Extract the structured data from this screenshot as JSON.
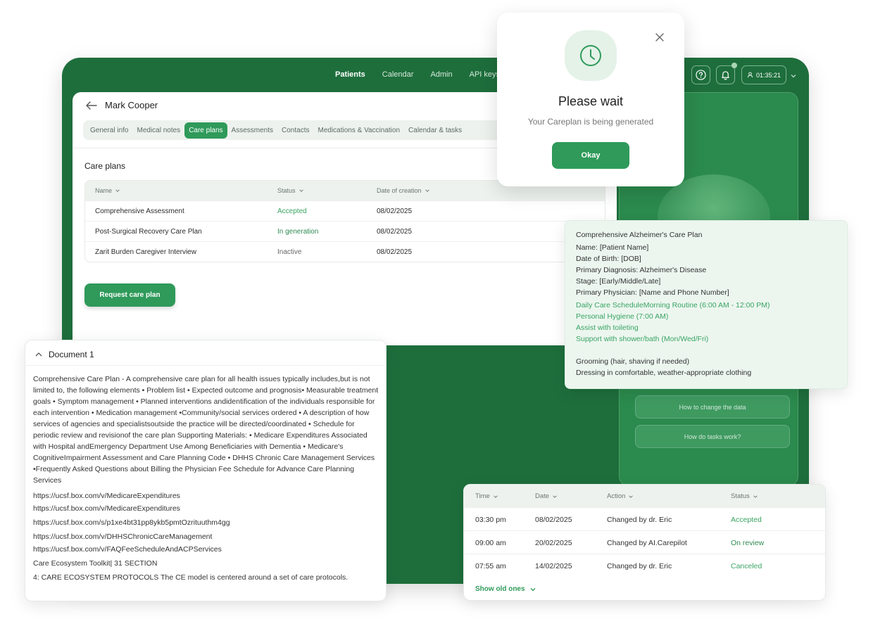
{
  "nav": {
    "items": [
      "Patients",
      "Calendar",
      "Admin",
      "API keys"
    ],
    "active": "Patients"
  },
  "header": {
    "timer": "01:35:21"
  },
  "patient": {
    "name": "Mark Cooper"
  },
  "tabs": [
    "General info",
    "Medical notes",
    "Care plans",
    "Assessments",
    "Contacts",
    "Medications & Vaccination",
    "Calendar & tasks"
  ],
  "active_tab": "Care plans",
  "care_plans": {
    "title": "Care plans",
    "columns": [
      "Name",
      "Status",
      "Date of creation"
    ],
    "rows": [
      {
        "name": "Comprehensive Assessment",
        "status": "Accepted",
        "date": "08/02/2025"
      },
      {
        "name": "Post-Surgical Recovery Care Plan",
        "status": "In generation",
        "date": "08/02/2025"
      },
      {
        "name": "Zarit Burden Caregiver Interview",
        "status": "Inactive",
        "date": "08/02/2025"
      }
    ],
    "request_button": "Request care plan"
  },
  "side_panel": {
    "buttons": [
      "How to change the data",
      "How do tasks work?"
    ]
  },
  "modal": {
    "title": "Please wait",
    "subtitle": "Your Careplan is being generated",
    "button": "Okay"
  },
  "alzheimer_card": {
    "title": "Comprehensive Alzheimer's Care Plan",
    "lines": [
      "Name: [Patient Name]",
      "Date of Birth: [DOB]",
      "Primary Diagnosis: Alzheimer's Disease",
      "Stage: [Early/Middle/Late]",
      "Primary Physician: [Name and Phone Number]"
    ],
    "green_lines": [
      "Daily Care ScheduleMorning Routine (6:00 AM - 12:00 PM)",
      "Personal Hygiene (7:00 AM)",
      "Assist with toileting",
      "Support with shower/bath (Mon/Wed/Fri)"
    ],
    "tail_lines": [
      "Grooming (hair, shaving if needed)",
      "Dressing in comfortable, weather-appropriate clothing"
    ]
  },
  "document": {
    "title": "Document 1",
    "paragraph": "Comprehensive Care Plan - A comprehensive care plan for all health issues typically includes,but is not limited to, the following elements • Problem list • Expected outcome and prognosis• Measurable treatment goals • Symptom management • Planned interventions andidentification of the individuals responsible for each intervention • Medication management •Community/social services ordered • A description of how services of agencies and specialistsoutside the practice will be directed/coordinated • Schedule for periodic review and revisionof the care plan Supporting Materials: • Medicare Expenditures Associated with Hospital andEmergency Department Use Among Beneficiaries with Dementia • Medicare's CognitiveImpairment Assessment and Care Planning Code • DHHS Chronic Care Management Services •Frequently Asked Questions about Billing the Physician Fee Schedule for Advance Care Planning Services",
    "links": [
      "https://ucsf.box.com/v/MedicareExpenditures",
      "https://ucsf.box.com/v/MedicareExpenditures",
      "https://ucsf.box.com/s/p1xe4bt31pp8ykb5pmtOzrituuthm4gg",
      "https://ucsf.box.com/v/DHHSChronicCareManagement",
      "https://ucsf.box.com/v/FAQFeeScheduleAndACPServices"
    ],
    "toolkit": "Care Ecosystem Toolkit| 31 SECTION",
    "protocols": "4: CARE ECOSYSTEM PROTOCOLS The CE model is centered around a set of care protocols."
  },
  "history": {
    "columns": [
      "Time",
      "Date",
      "Action",
      "Status"
    ],
    "rows": [
      {
        "time": "03:30 pm",
        "date": "08/02/2025",
        "action": "Changed by dr. Eric",
        "status": "Accepted"
      },
      {
        "time": "09:00 am",
        "date": "20/02/2025",
        "action": "Changed by AI.Carepilot",
        "status": "On review"
      },
      {
        "time": "07:55 am",
        "date": "14/02/2025",
        "action": "Changed by dr. Eric",
        "status": "Canceled"
      }
    ],
    "show_old": "Show old ones"
  },
  "colors": {
    "brand_green": "#1e6e3c",
    "accent": "#2f9a5a",
    "status_green": "#3aa463"
  }
}
